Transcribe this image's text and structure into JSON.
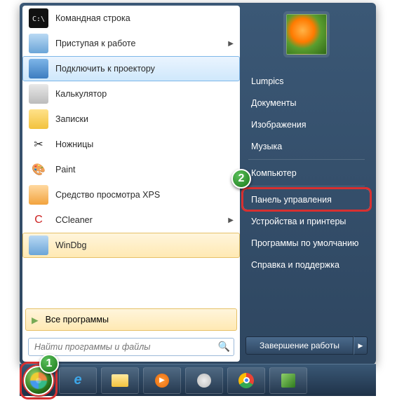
{
  "programs": [
    {
      "icon": "cmd-icon",
      "label": "Командная строка",
      "arrow": false,
      "cls": "i-cmd",
      "glyph": "C:\\"
    },
    {
      "icon": "getting-started-icon",
      "label": "Приступая к работе",
      "arrow": true,
      "cls": "i-start",
      "glyph": ""
    },
    {
      "icon": "projector-icon",
      "label": "Подключить к проектору",
      "arrow": false,
      "cls": "i-proj",
      "glyph": "",
      "selected": true
    },
    {
      "icon": "calculator-icon",
      "label": "Калькулятор",
      "arrow": false,
      "cls": "i-calc",
      "glyph": ""
    },
    {
      "icon": "sticky-notes-icon",
      "label": "Записки",
      "arrow": false,
      "cls": "i-note",
      "glyph": ""
    },
    {
      "icon": "snipping-icon",
      "label": "Ножницы",
      "arrow": false,
      "cls": "i-snip",
      "glyph": "✂"
    },
    {
      "icon": "paint-icon",
      "label": "Paint",
      "arrow": false,
      "cls": "i-paint",
      "glyph": "🎨"
    },
    {
      "icon": "xps-icon",
      "label": "Средство просмотра XPS",
      "arrow": false,
      "cls": "i-xps",
      "glyph": ""
    },
    {
      "icon": "ccleaner-icon",
      "label": "CCleaner",
      "arrow": true,
      "cls": "i-cc",
      "glyph": "C"
    },
    {
      "icon": "windbg-icon",
      "label": "WinDbg",
      "arrow": false,
      "cls": "i-dbg",
      "glyph": "",
      "selected2": true
    }
  ],
  "all_programs": "Все программы",
  "search_placeholder": "Найти программы и файлы",
  "right_items": [
    "Lumpics",
    "Документы",
    "Изображения",
    "Музыка",
    "—",
    "Компьютер",
    "—",
    "Панель управления",
    "Устройства и принтеры",
    "Программы по умолчанию",
    "Справка и поддержка"
  ],
  "right_highlight_index": 7,
  "shutdown": "Завершение работы",
  "markers": {
    "one": "1",
    "two": "2"
  },
  "taskbar_icons": [
    "ie",
    "explorer",
    "wmp",
    "blank",
    "chrome",
    "cube"
  ]
}
